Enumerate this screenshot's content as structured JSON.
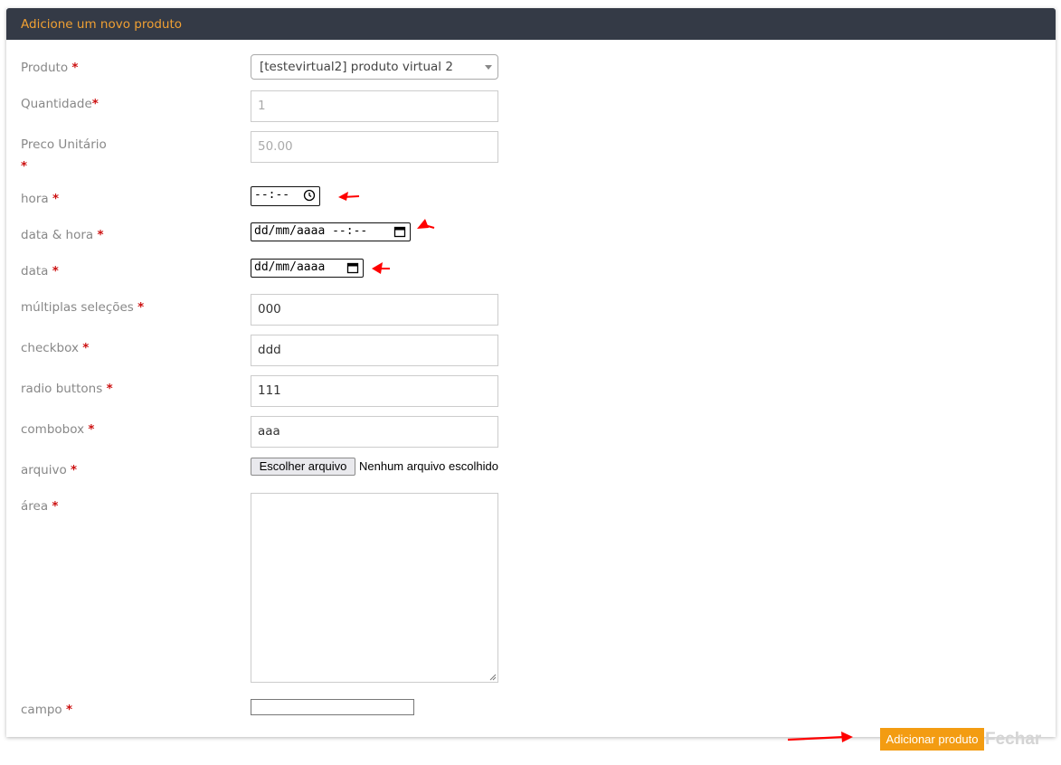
{
  "header": {
    "title": "Adicione um novo produto"
  },
  "required_mark": "*",
  "accent_color": "#f39c12",
  "header_bg": "#343a46",
  "annotation_color": "#ff0000",
  "form": {
    "produto": {
      "label": "Produto",
      "value": "[testevirtual2] produto virtual 2"
    },
    "quantidade": {
      "label": "Quantidade",
      "value": "1"
    },
    "preco": {
      "label": "Preco Unitário",
      "value": "50.00"
    },
    "hora": {
      "label": "hora",
      "value": "--:--"
    },
    "data_hora": {
      "label": "data & hora",
      "value": "dd/mm/aaaa --:--"
    },
    "data": {
      "label": "data",
      "value": "dd/mm/aaaa"
    },
    "multiplas": {
      "label": "múltiplas seleções",
      "value": "000"
    },
    "checkbox": {
      "label": "checkbox",
      "value": "ddd"
    },
    "radio": {
      "label": "radio buttons",
      "value": "111"
    },
    "combobox": {
      "label": "combobox",
      "value": "aaa"
    },
    "arquivo": {
      "label": "arquivo",
      "button": "Escolher arquivo",
      "status": "Nenhum arquivo escolhido"
    },
    "area": {
      "label": "área",
      "value": ""
    },
    "campo": {
      "label": "campo",
      "value": ""
    }
  },
  "footer": {
    "add_label": "Adicionar produto",
    "close_label": "Fechar"
  }
}
